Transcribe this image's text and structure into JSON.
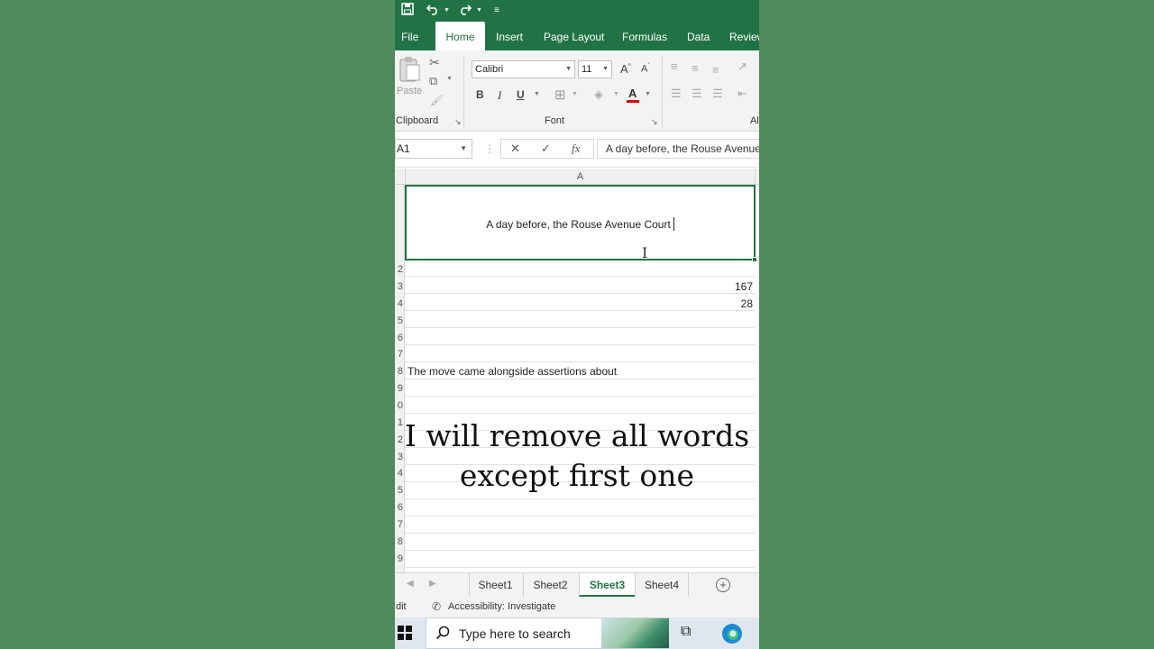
{
  "qat": {
    "save_icon": "save-icon",
    "undo_icon": "undo-icon",
    "redo_icon": "redo-icon"
  },
  "tabs": [
    {
      "label": "File"
    },
    {
      "label": "Home"
    },
    {
      "label": "Insert"
    },
    {
      "label": "Page Layout"
    },
    {
      "label": "Formulas"
    },
    {
      "label": "Data"
    },
    {
      "label": "Review"
    }
  ],
  "ribbon": {
    "paste_label": "Paste",
    "clipboard_label": "Clipboard",
    "font_label": "Font",
    "alignment_label_partial": "Al",
    "font_name": "Calibri",
    "font_size": "11",
    "bold": "B",
    "italic": "I",
    "underline": "U",
    "grow_font": "A",
    "shrink_font": "A",
    "font_color_letter": "A"
  },
  "formula_bar": {
    "name_box": "A1",
    "cancel": "✕",
    "enter": "✓",
    "fx": "fx",
    "content": "A day before, the Rouse Avenue Court"
  },
  "grid": {
    "column_header": "A",
    "row_numbers": [
      "2",
      "3",
      "4",
      "5",
      "6",
      "7",
      "8",
      "9",
      "0",
      "1",
      "2",
      "3",
      "4",
      "5",
      "6",
      "7",
      "8",
      "9"
    ],
    "a1": "A day before, the Rouse Avenue Court",
    "cells": {
      "a3": "167",
      "a4": "28",
      "a8": "The move came alongside assertions about"
    }
  },
  "caption": "I will remove all words except first one",
  "sheets": {
    "tabs": [
      {
        "label": "Sheet1",
        "active": false
      },
      {
        "label": "Sheet2",
        "active": false
      },
      {
        "label": "Sheet3",
        "active": true
      },
      {
        "label": "Sheet4",
        "active": false
      }
    ],
    "add_symbol": "+"
  },
  "status": {
    "mode": "dit",
    "accessibility": "Accessibility: Investigate"
  },
  "taskbar": {
    "search_placeholder": "Type here to search"
  },
  "colors": {
    "excel_green": "#217346",
    "background_green": "#4f8a5c",
    "font_color_red": "#e00000"
  }
}
